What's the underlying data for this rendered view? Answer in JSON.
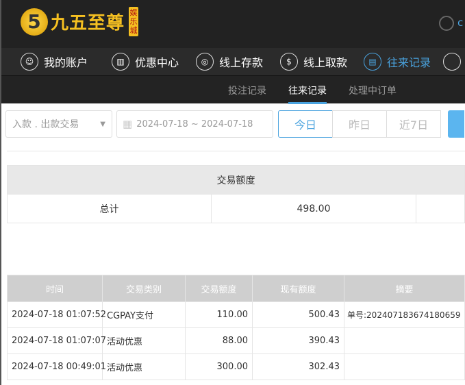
{
  "header": {
    "logo_text": "九五至尊",
    "logo_badge": "娱乐城",
    "user_partial": "c"
  },
  "nav": [
    {
      "label": "我的账户",
      "icon": "user-icon"
    },
    {
      "label": "优惠中心",
      "icon": "gift-icon"
    },
    {
      "label": "线上存款",
      "icon": "deposit-icon"
    },
    {
      "label": "线上取款",
      "icon": "withdraw-icon"
    },
    {
      "label": "往来记录",
      "icon": "record-icon",
      "active": true
    }
  ],
  "subtabs": [
    "投注记录",
    "往来记录",
    "处理中订单"
  ],
  "filters": {
    "type": "入款 . 出款交易",
    "date_range": "2024-07-18 ~ 2024-07-18",
    "buttons": [
      "今日",
      "昨日",
      "近7日"
    ]
  },
  "summary": {
    "header": "交易额度",
    "label": "总计",
    "value": "498.00"
  },
  "table": {
    "headers": [
      "时间",
      "交易类别",
      "交易额度",
      "现有额度",
      "摘要"
    ],
    "rows": [
      [
        "2024-07-18 01:07:52",
        "CGPAY支付",
        "110.00",
        "500.43",
        "单号:202407183674180659"
      ],
      [
        "2024-07-18 01:07:07",
        "活动优惠",
        "88.00",
        "390.43",
        ""
      ],
      [
        "2024-07-18 00:49:01",
        "活动优惠",
        "300.00",
        "302.43",
        ""
      ]
    ]
  },
  "colors": {
    "accent": "#4aa3df",
    "gold": "#f5c021"
  }
}
